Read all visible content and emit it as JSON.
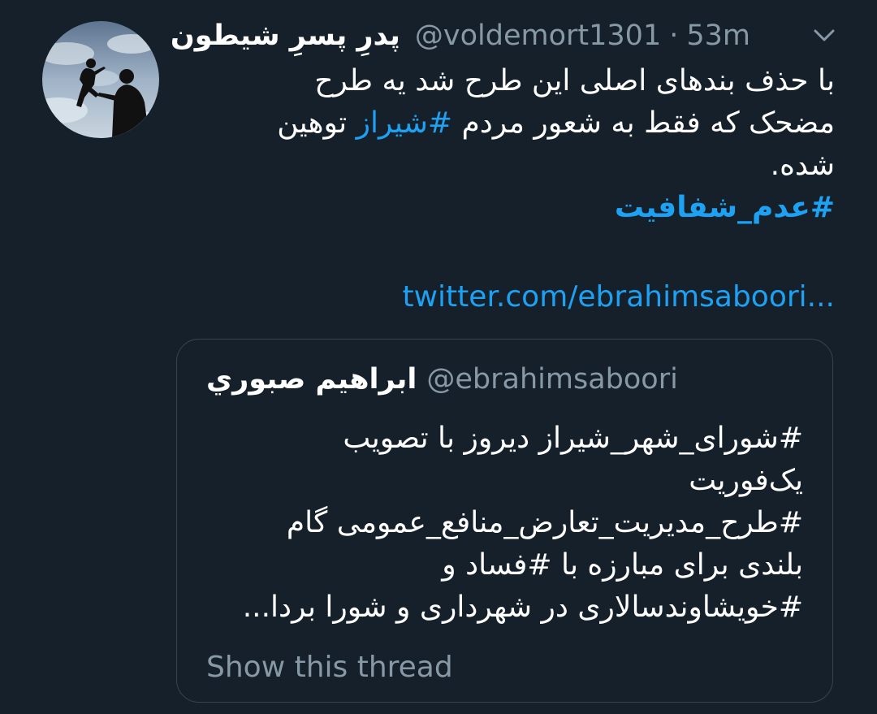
{
  "tweet": {
    "author_name": "پدرِ پسرِ شیطون",
    "handle": "@voldemort1301",
    "separator": "·",
    "time": "53m",
    "menu_icon": "chevron-down-icon",
    "text_lines": [
      "با حذف بندهای اصلی این طرح شد یه طرح",
      "توهین",
      "#شیراز",
      "مضحک که فقط به شعور مردم",
      "شده."
    ],
    "hashtag": "#عدم_شفافیت",
    "link": "twitter.com/ebrahimsaboori..."
  },
  "quote": {
    "author_name": "ابراهیم صبوري",
    "handle": "@ebrahimsaboori",
    "text_lines": [
      "#شورای_شهر_شیراز دیروز با تصویب",
      "یک‌فوریت",
      "#طرح_مدیریت_تعارض_منافع_عمومی گام",
      "بلندی برای مبارزه با #فساد و",
      "#خویشاوندسالاری در شهرداری و شورا بردا..."
    ],
    "show_thread": "Show this thread"
  },
  "colors": {
    "background": "#15202b",
    "link": "#1da1f2",
    "muted": "#8899a6",
    "border": "#38444d"
  }
}
